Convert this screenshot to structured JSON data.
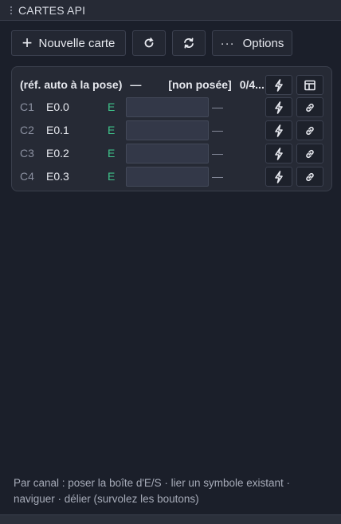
{
  "panel": {
    "title": "CARTES API"
  },
  "toolbar": {
    "new_card_icon": "+",
    "new_card_label": "Nouvelle carte",
    "refresh_icon": "refresh-icon",
    "sync_icon": "sync-icon",
    "options_icon": "···",
    "options_label": "Options"
  },
  "card": {
    "header": {
      "ref": "(réf. auto à la pose)",
      "separator": "—",
      "status": "[non posée]",
      "count": "0/4..."
    },
    "rows": [
      {
        "channel": "C1",
        "address": "E0.0",
        "type": "E",
        "symbol": "",
        "link": "—"
      },
      {
        "channel": "C2",
        "address": "E0.1",
        "type": "E",
        "symbol": "",
        "link": "—"
      },
      {
        "channel": "C3",
        "address": "E0.2",
        "type": "E",
        "symbol": "",
        "link": "—"
      },
      {
        "channel": "C4",
        "address": "E0.3",
        "type": "E",
        "symbol": "",
        "link": "—"
      }
    ]
  },
  "footer": {
    "hint": "Par canal : poser la boîte d'E/S · lier un symbole existant · naviguer · délier (survolez les boutons)"
  },
  "colors": {
    "background": "#1b1f2a",
    "card": "#262a35",
    "input_type_green": "#3fc38a"
  }
}
